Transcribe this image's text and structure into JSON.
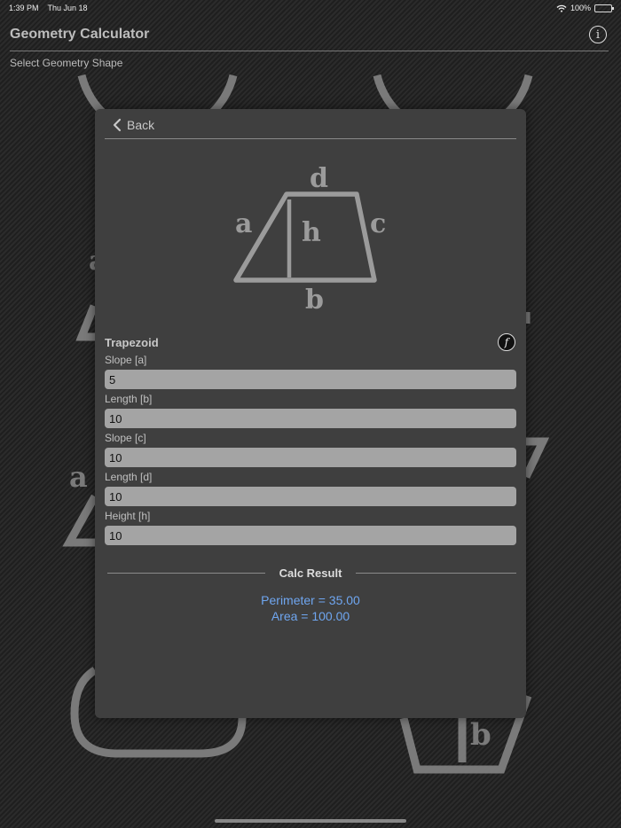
{
  "status_bar": {
    "time": "1:39 PM",
    "date": "Thu Jun 18",
    "battery": "100%"
  },
  "header": {
    "title": "Geometry Calculator",
    "info_icon": "i"
  },
  "subtitle": "Select Geometry Shape",
  "background_labels": {
    "left_a": "a",
    "left_a2": "a",
    "right_b": "b"
  },
  "modal": {
    "back_label": "Back",
    "diagram_labels": {
      "a": "a",
      "b": "b",
      "c": "c",
      "d": "d",
      "h": "h"
    },
    "shape_name": "Trapezoid",
    "formula_icon": "f",
    "fields": [
      {
        "label": "Slope [a]",
        "value": "5"
      },
      {
        "label": "Length [b]",
        "value": "10"
      },
      {
        "label": "Slope [c]",
        "value": "10"
      },
      {
        "label": "Length [d]",
        "value": "10"
      },
      {
        "label": "Height [h]",
        "value": "10"
      }
    ],
    "result_title": "Calc Result",
    "results": {
      "perimeter": "Perimeter = 35.00",
      "area": "Area = 100.00"
    }
  },
  "colors": {
    "result_text": "#6fa6f0",
    "field_background": "#a4a4a4",
    "modal_background": "#3f3f3f"
  }
}
